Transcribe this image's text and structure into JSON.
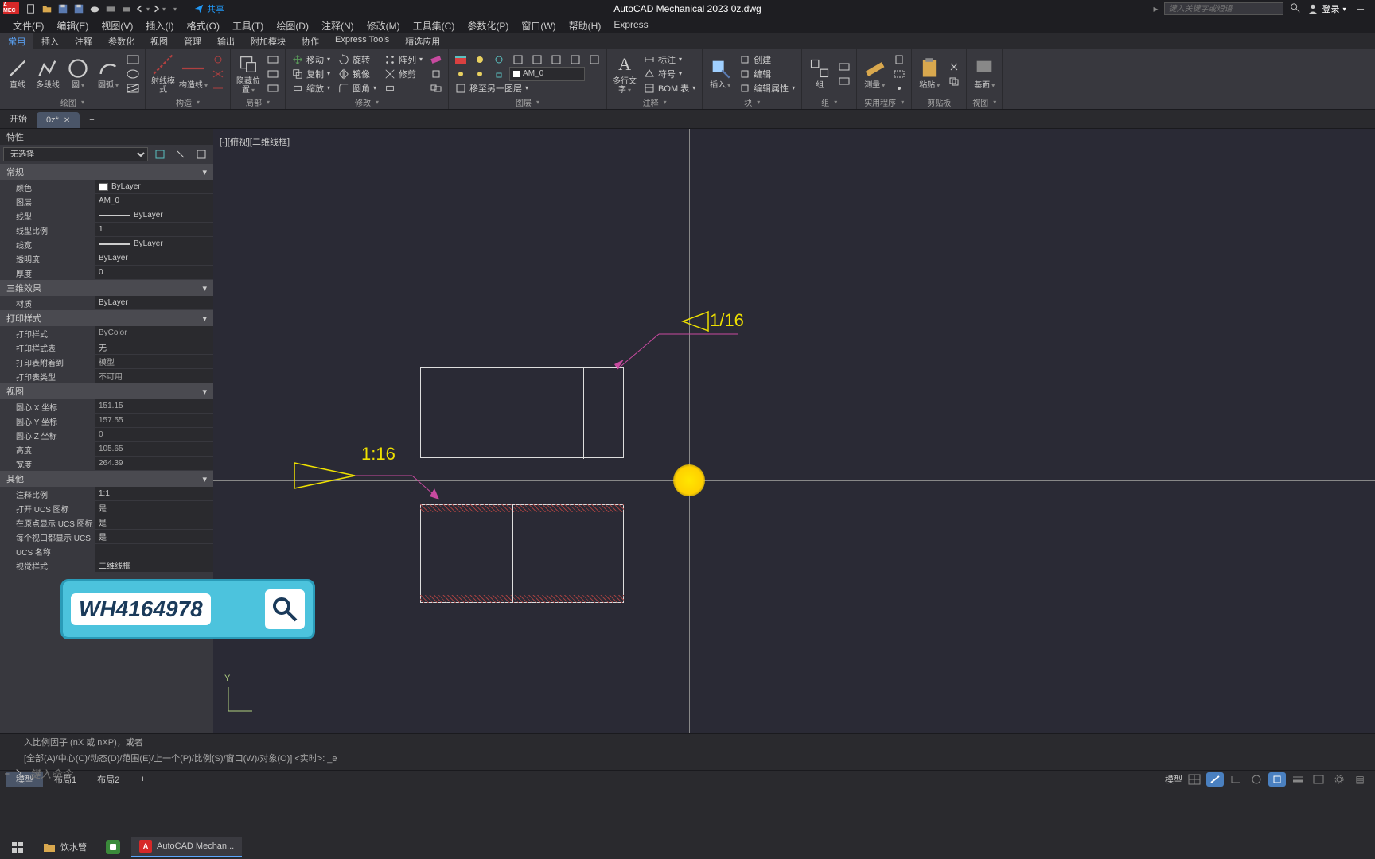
{
  "title": "AutoCAD Mechanical 2023    0z.dwg",
  "share": "共享",
  "search_placeholder": "键入关键字或短语",
  "login": "登录",
  "menus": [
    "文件(F)",
    "编辑(E)",
    "视图(V)",
    "插入(I)",
    "格式(O)",
    "工具(T)",
    "绘图(D)",
    "注释(N)",
    "修改(M)",
    "工具集(C)",
    "参数化(P)",
    "窗口(W)",
    "帮助(H)",
    "Express"
  ],
  "ribbon_tabs": [
    "常用",
    "插入",
    "注释",
    "参数化",
    "视图",
    "管理",
    "输出",
    "附加模块",
    "协作",
    "Express Tools",
    "精选应用"
  ],
  "panels": {
    "draw": {
      "label": "绘图",
      "line": "直线",
      "polyline": "多段线",
      "circle": "圆",
      "arc": "圆弧"
    },
    "construct": {
      "label": "构造",
      "ray": "射线模式",
      "conline": "构造线"
    },
    "edit": {
      "label": "局部",
      "hide": "隐藏位置"
    },
    "modify": {
      "label": "修改",
      "move": "移动",
      "copy": "复制",
      "stretch": "缩放",
      "rotate": "旋转",
      "mirror": "镜像",
      "fillet": "圆角",
      "array": "阵列",
      "trim": "修剪",
      "move_to_layer": "移至另一图层"
    },
    "layers": {
      "label": "图层",
      "current": "AM_0"
    },
    "annotation": {
      "label": "注释",
      "mtext": "多行文字",
      "dim": "标注",
      "sym": "符号",
      "bom": "BOM 表"
    },
    "block": {
      "label": "块",
      "insert": "插入",
      "create": "创建",
      "edit": "编辑",
      "editprop": "编辑属性"
    },
    "group": {
      "label": "组",
      "group": "组"
    },
    "utility": {
      "label": "实用程序",
      "measure": "测量"
    },
    "clipboard": {
      "label": "剪贴板",
      "paste": "粘贴"
    },
    "view": {
      "label": "视图",
      "base": "基面"
    }
  },
  "doc_tabs": {
    "start": "开始",
    "current": "0z*",
    "add": "+"
  },
  "props": {
    "title": "特性",
    "selection": "无选择",
    "sections": {
      "general": "常规",
      "threed": "三维效果",
      "plot": "打印样式",
      "view": "视图",
      "misc": "其他"
    },
    "rows": {
      "color_l": "颜色",
      "color_v": "ByLayer",
      "layer_l": "图层",
      "layer_v": "AM_0",
      "ltype_l": "线型",
      "ltype_v": "ByLayer",
      "ltscale_l": "线型比例",
      "ltscale_v": "1",
      "lweight_l": "线宽",
      "lweight_v": "ByLayer",
      "transp_l": "透明度",
      "transp_v": "ByLayer",
      "thick_l": "厚度",
      "thick_v": "0",
      "material_l": "材质",
      "material_v": "ByLayer",
      "pstyle_l": "打印样式",
      "pstyle_v": "ByColor",
      "pstable_l": "打印样式表",
      "pstable_v": "无",
      "psattach_l": "打印表附着到",
      "psattach_v": "模型",
      "pstype_l": "打印表类型",
      "pstype_v": "不可用",
      "cx_l": "圆心 X 坐标",
      "cx_v": "151.15",
      "cy_l": "圆心 Y 坐标",
      "cy_v": "157.55",
      "cz_l": "圆心 Z 坐标",
      "cz_v": "0",
      "height_l": "高度",
      "height_v": "105.65",
      "width_l": "宽度",
      "width_v": "264.39",
      "annoscale_l": "注释比例",
      "annoscale_v": "1:1",
      "ucsicon_l": "打开 UCS 图标",
      "ucsicon_v": "是",
      "ucsorigin_l": "在原点显示 UCS 图标",
      "ucsorigin_v": "是",
      "ucsperv_l": "每个视口都显示 UCS",
      "ucsperv_v": "是",
      "ucsname_l": "UCS 名称",
      "ucsname_v": "",
      "vstyle_l": "视觉样式",
      "vstyle_v": "二维线框"
    }
  },
  "viewport_label": "[-][俯视][二维线框]",
  "drawing": {
    "ratio1": "1/16",
    "ratio2": "1:16"
  },
  "cmd": {
    "line1": "入比例因子 (nX 或 nXP)，或者",
    "line2": "[全部(A)/中心(C)/动态(D)/范围(E)/上一个(P)/比例(S)/窗口(W)/对象(O)] <实时>: _e",
    "prompt": "键入命令"
  },
  "ucs_y": "Y",
  "layout_tabs": {
    "model": "模型",
    "l1": "布局1",
    "l2": "布局2"
  },
  "status_model": "模型",
  "taskbar": {
    "folder": "饮水管",
    "app": "AutoCAD Mechan..."
  },
  "watermark": "WH4164978"
}
